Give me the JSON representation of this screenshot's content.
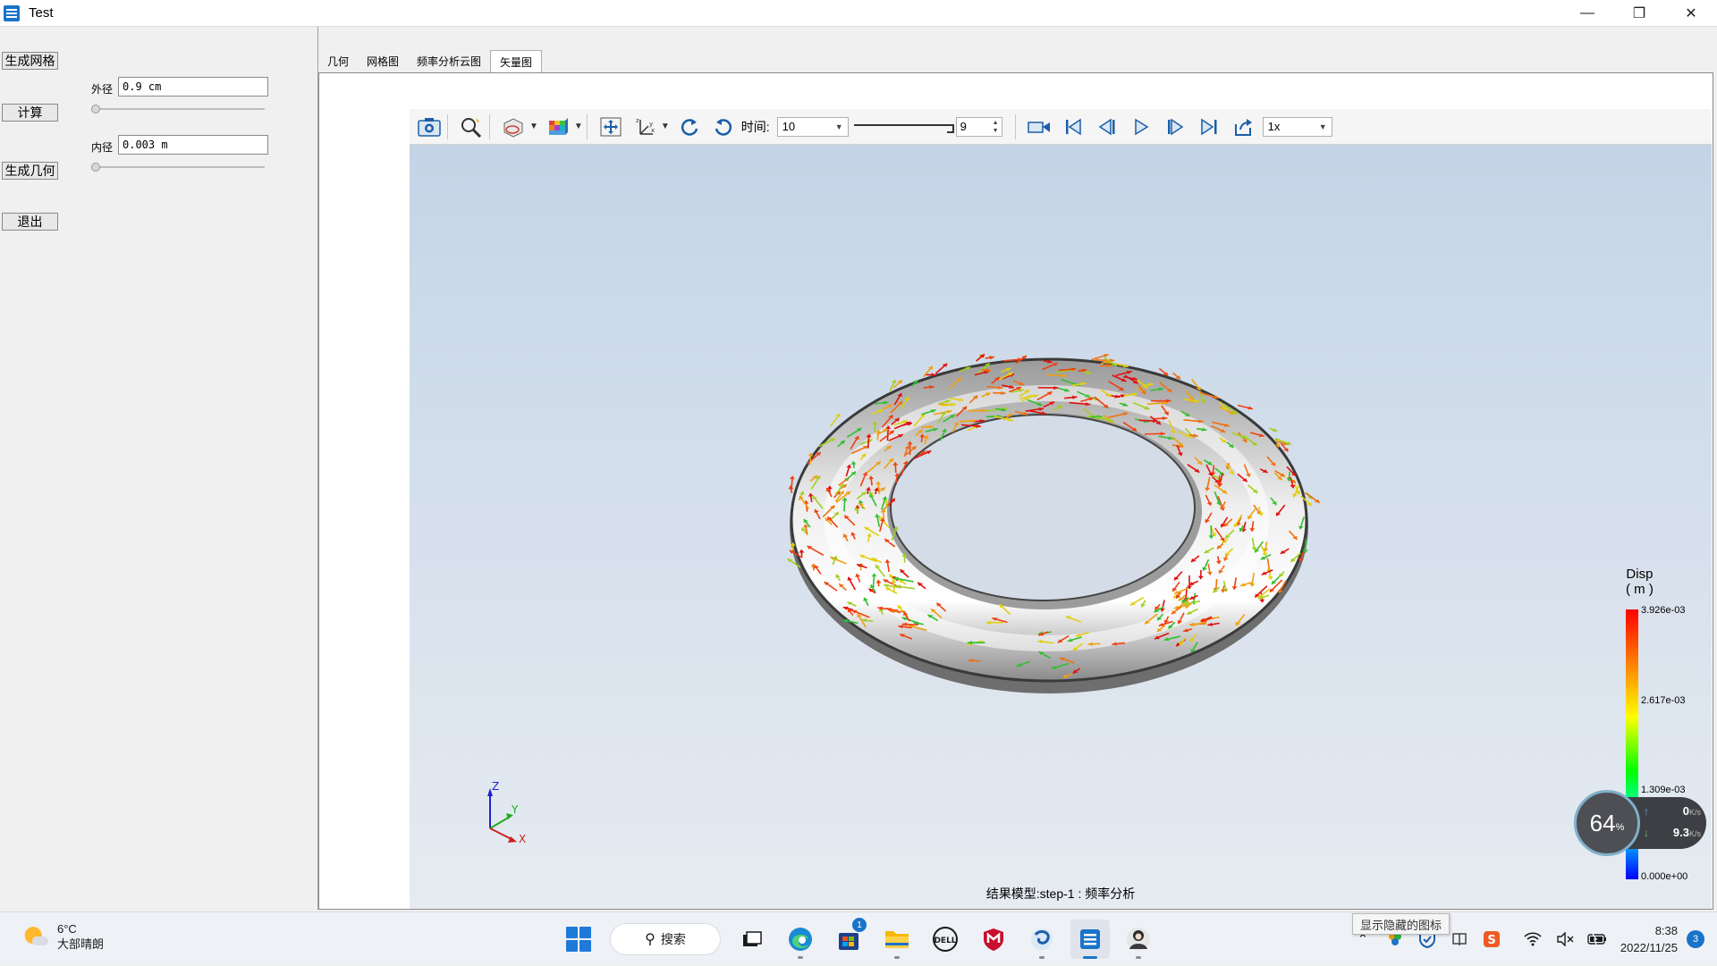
{
  "window": {
    "title": "Test"
  },
  "left_panel": {
    "btn_mesh": "生成网格",
    "outer_label": "外径",
    "outer_value": "0.9 cm",
    "btn_compute": "计算",
    "inner_label": "内径",
    "inner_value": "0.003 m",
    "btn_geometry": "生成几何",
    "btn_exit": "退出"
  },
  "tabs": [
    "几何",
    "网格图",
    "频率分析云图",
    "矢量图"
  ],
  "active_tab": "矢量图",
  "toolbar": {
    "time_label": "时间:",
    "time_value": "10",
    "frame_value": "9",
    "speed_value": "1x"
  },
  "viewport": {
    "result_caption": "结果模型:step-1 : 频率分析",
    "axis_labels": {
      "z": "Z",
      "y": "Y",
      "x": "X"
    },
    "legend": {
      "title": "Disp",
      "unit": "( m )",
      "labels": [
        "3.926e-03",
        "2.617e-03",
        "1.309e-03",
        "0.000e+00"
      ],
      "colors": [
        "#ff0000",
        "#ff8000",
        "#ffff00",
        "#00ff00",
        "#00ffff",
        "#0000ff"
      ]
    }
  },
  "net_monitor": {
    "percent": "64",
    "percent_unit": "%",
    "up": "0",
    "down": "9.3",
    "unit": "K/s"
  },
  "taskbar": {
    "weather_temp": "6°C",
    "weather_desc": "大部晴朗",
    "search_label": "搜索",
    "store_badge": "1",
    "tooltip": "显示隐藏的图标",
    "time": "8:38",
    "date": "2022/11/25",
    "notifications": "3"
  }
}
